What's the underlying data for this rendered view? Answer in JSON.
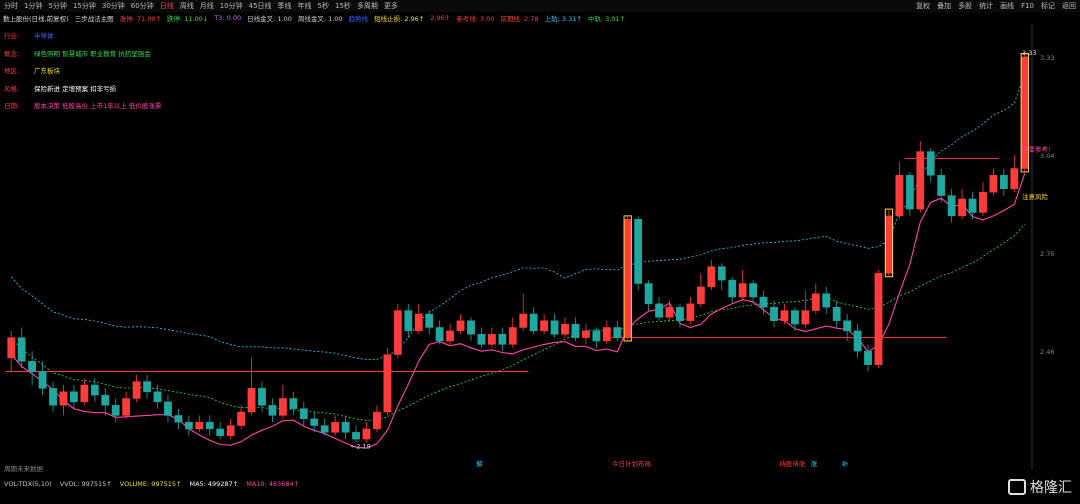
{
  "toolbar": {
    "periods": [
      "分时",
      "1分钟",
      "5分钟",
      "15分钟",
      "30分钟",
      "60分钟",
      "日线",
      "周线",
      "月线",
      "10分钟",
      "45日线",
      "季线",
      "年线",
      "5秒",
      "15秒",
      "多周期",
      "更多"
    ],
    "active_period": "日线",
    "right": [
      "复权",
      "叠加",
      "多股",
      "统计",
      "画线",
      "F10",
      "标记",
      "返回"
    ]
  },
  "indicator_line": {
    "stock": "勤上股份(日线,前复权)",
    "strategy": "三步战法主图",
    "items": [
      {
        "text": "涨停: 71.00↑",
        "color": "#ff3b3b"
      },
      {
        "text": "跌停: 11.00↓",
        "color": "#33dd55"
      },
      {
        "text": "T3: 0.00",
        "color": "#cc66ff"
      },
      {
        "text": "日线金叉: 1.00",
        "color": "#cccccc"
      },
      {
        "text": "周线金叉: 1.00",
        "color": "#cccccc"
      },
      {
        "text": "趋势线",
        "color": "#4466ff"
      },
      {
        "text": "短线止损: 2.96↑",
        "color": "#ffdd33"
      },
      {
        "text": "2.96↑",
        "color": "#ff3b3b"
      },
      {
        "text": "参考线: 3.00",
        "color": "#ff3b3b"
      },
      {
        "text": "前期线: 2.78",
        "color": "#ff3b3b"
      },
      {
        "text": "上轨: 3.31↑",
        "color": "#33ccff"
      },
      {
        "text": "中轨: 3.01↑",
        "color": "#33dd55"
      }
    ]
  },
  "info_rows": [
    {
      "key": "行业:",
      "value": "半导体",
      "color": "#4466ff"
    },
    {
      "key": "概念:",
      "value": "绿色照明 智慧城市 职业教育 抗药坚强会",
      "color": "#33dd55"
    },
    {
      "key": "地区:",
      "value": "广东板块",
      "color": "#ffdd33"
    },
    {
      "key": "风格:",
      "value": "保险新进 定增预案 扣非亏损",
      "color": "#ffffff"
    },
    {
      "key": "日期:",
      "value": "股本决策 低股高价 上市1年以上 低价股涨票",
      "color": "#ff44aa"
    }
  ],
  "chart_data": {
    "type": "candlestick",
    "price_labels": [
      "3.33",
      "3.04",
      "2.75",
      "2.46"
    ],
    "annotations": {
      "low_label": "←2.19",
      "resistance": "重要参考!",
      "attention": "注意风险",
      "day_buy": "今日计划布局",
      "hold": "持股待涨",
      "marks": [
        "解",
        "涨",
        "补"
      ]
    },
    "candles": [
      [
        2.44,
        2.5,
        2.52,
        2.4
      ],
      [
        2.5,
        2.43,
        2.53,
        2.41
      ],
      [
        2.43,
        2.4,
        2.46,
        2.36
      ],
      [
        2.4,
        2.35,
        2.43,
        2.33
      ],
      [
        2.35,
        2.3,
        2.37,
        2.28
      ],
      [
        2.3,
        2.34,
        2.36,
        2.27
      ],
      [
        2.34,
        2.31,
        2.36,
        2.29
      ],
      [
        2.31,
        2.36,
        2.38,
        2.3
      ],
      [
        2.36,
        2.33,
        2.38,
        2.31
      ],
      [
        2.33,
        2.3,
        2.35,
        2.27
      ],
      [
        2.3,
        2.27,
        2.32,
        2.25
      ],
      [
        2.27,
        2.32,
        2.34,
        2.26
      ],
      [
        2.32,
        2.37,
        2.39,
        2.31
      ],
      [
        2.37,
        2.34,
        2.39,
        2.32
      ],
      [
        2.34,
        2.31,
        2.36,
        2.29
      ],
      [
        2.31,
        2.27,
        2.33,
        2.25
      ],
      [
        2.27,
        2.25,
        2.29,
        2.23
      ],
      [
        2.25,
        2.23,
        2.27,
        2.21
      ],
      [
        2.23,
        2.25,
        2.27,
        2.22
      ],
      [
        2.25,
        2.23,
        2.27,
        2.21
      ],
      [
        2.23,
        2.21,
        2.25,
        2.2
      ],
      [
        2.21,
        2.24,
        2.26,
        2.2
      ],
      [
        2.24,
        2.28,
        2.3,
        2.23
      ],
      [
        2.28,
        2.35,
        2.44,
        2.27
      ],
      [
        2.35,
        2.3,
        2.37,
        2.28
      ],
      [
        2.3,
        2.27,
        2.32,
        2.25
      ],
      [
        2.27,
        2.32,
        2.36,
        2.26
      ],
      [
        2.32,
        2.29,
        2.34,
        2.27
      ],
      [
        2.29,
        2.26,
        2.31,
        2.24
      ],
      [
        2.26,
        2.24,
        2.28,
        2.22
      ],
      [
        2.24,
        2.22,
        2.26,
        2.21
      ],
      [
        2.22,
        2.25,
        2.27,
        2.21
      ],
      [
        2.25,
        2.22,
        2.27,
        2.2
      ],
      [
        2.22,
        2.2,
        2.24,
        2.19
      ],
      [
        2.2,
        2.23,
        2.25,
        2.19
      ],
      [
        2.23,
        2.28,
        2.3,
        2.22
      ],
      [
        2.28,
        2.45,
        2.47,
        2.27
      ],
      [
        2.45,
        2.58,
        2.6,
        2.44
      ],
      [
        2.58,
        2.52,
        2.6,
        2.5
      ],
      [
        2.52,
        2.57,
        2.6,
        2.51
      ],
      [
        2.57,
        2.53,
        2.58,
        2.51
      ],
      [
        2.53,
        2.49,
        2.55,
        2.48
      ],
      [
        2.49,
        2.52,
        2.54,
        2.48
      ],
      [
        2.52,
        2.55,
        2.57,
        2.51
      ],
      [
        2.55,
        2.51,
        2.56,
        2.49
      ],
      [
        2.51,
        2.48,
        2.53,
        2.47
      ],
      [
        2.48,
        2.51,
        2.53,
        2.47
      ],
      [
        2.51,
        2.48,
        2.53,
        2.46
      ],
      [
        2.48,
        2.53,
        2.56,
        2.47
      ],
      [
        2.53,
        2.57,
        2.63,
        2.52
      ],
      [
        2.57,
        2.52,
        2.59,
        2.51
      ],
      [
        2.52,
        2.55,
        2.57,
        2.51
      ],
      [
        2.55,
        2.51,
        2.57,
        2.5
      ],
      [
        2.51,
        2.54,
        2.56,
        2.5
      ],
      [
        2.54,
        2.5,
        2.56,
        2.49
      ],
      [
        2.5,
        2.52,
        2.54,
        2.48
      ],
      [
        2.52,
        2.49,
        2.53,
        2.47
      ],
      [
        2.49,
        2.53,
        2.55,
        2.48
      ],
      [
        2.53,
        2.5,
        2.55,
        2.49
      ],
      [
        2.5,
        2.85,
        2.86,
        2.49
      ],
      [
        2.85,
        2.66,
        2.86,
        2.64
      ],
      [
        2.66,
        2.6,
        2.67,
        2.58
      ],
      [
        2.6,
        2.56,
        2.62,
        2.55
      ],
      [
        2.56,
        2.59,
        2.61,
        2.55
      ],
      [
        2.59,
        2.55,
        2.6,
        2.53
      ],
      [
        2.55,
        2.6,
        2.62,
        2.54
      ],
      [
        2.6,
        2.65,
        2.69,
        2.59
      ],
      [
        2.65,
        2.71,
        2.73,
        2.64
      ],
      [
        2.71,
        2.67,
        2.72,
        2.64
      ],
      [
        2.67,
        2.62,
        2.68,
        2.6
      ],
      [
        2.62,
        2.66,
        2.7,
        2.61
      ],
      [
        2.66,
        2.62,
        2.67,
        2.6
      ],
      [
        2.62,
        2.59,
        2.64,
        2.57
      ],
      [
        2.59,
        2.55,
        2.61,
        2.53
      ],
      [
        2.55,
        2.58,
        2.6,
        2.54
      ],
      [
        2.58,
        2.54,
        2.59,
        2.52
      ],
      [
        2.54,
        2.58,
        2.64,
        2.53
      ],
      [
        2.58,
        2.63,
        2.66,
        2.57
      ],
      [
        2.63,
        2.59,
        2.65,
        2.57
      ],
      [
        2.59,
        2.55,
        2.61,
        2.53
      ],
      [
        2.55,
        2.52,
        2.57,
        2.49
      ],
      [
        2.52,
        2.46,
        2.54,
        2.44
      ],
      [
        2.46,
        2.42,
        2.48,
        2.4
      ],
      [
        2.42,
        2.69,
        2.7,
        2.41
      ],
      [
        2.69,
        2.86,
        2.88,
        2.68
      ],
      [
        2.86,
        2.98,
        3.02,
        2.85
      ],
      [
        2.98,
        2.88,
        2.99,
        2.86
      ],
      [
        2.88,
        3.05,
        3.08,
        2.87
      ],
      [
        3.05,
        2.98,
        3.06,
        2.96
      ],
      [
        2.98,
        2.92,
        3.0,
        2.9
      ],
      [
        2.92,
        2.86,
        2.94,
        2.84
      ],
      [
        2.86,
        2.91,
        2.94,
        2.85
      ],
      [
        2.91,
        2.87,
        2.93,
        2.85
      ],
      [
        2.87,
        2.93,
        2.96,
        2.86
      ],
      [
        2.93,
        2.98,
        3.0,
        2.92
      ],
      [
        2.98,
        2.94,
        3.0,
        2.92
      ],
      [
        2.94,
        3.0,
        3.04,
        2.93
      ],
      [
        3.0,
        3.33,
        3.34,
        2.99
      ]
    ]
  },
  "volume_line": {
    "items": [
      {
        "text": "VOL-TDX(5,10)",
        "color": "#cccccc"
      },
      {
        "text": "VVOL: 997515↑",
        "color": "#cccccc"
      },
      {
        "text": "VOLUME: 997515↑",
        "color": "#ffdd33"
      },
      {
        "text": "MA5: 499287↑",
        "color": "#ffffff"
      },
      {
        "text": "MA10: 483684↑",
        "color": "#ff44aa"
      }
    ]
  },
  "no_data_text": "周期未来数据",
  "logo_text": "格隆汇",
  "colors": {
    "up": "#ff3b3b",
    "down": "#1fa7a0",
    "bg": "#000000",
    "mid": "#33dd55",
    "upper": "#33ccff"
  }
}
